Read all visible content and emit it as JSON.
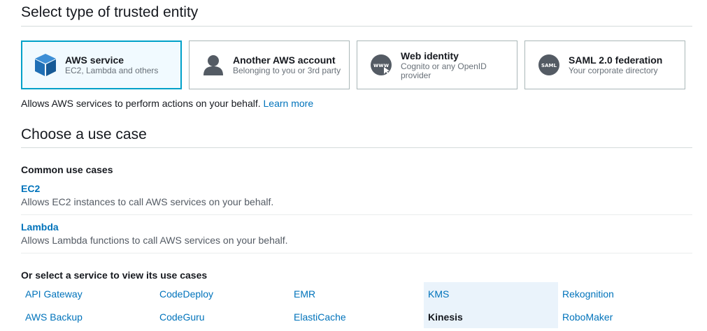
{
  "trusted_entity": {
    "title": "Select type of trusted entity",
    "cards": [
      {
        "title": "AWS service",
        "subtitle": "EC2, Lambda and others",
        "icon": "cube-icon",
        "selected": true
      },
      {
        "title": "Another AWS account",
        "subtitle": "Belonging to you or 3rd party",
        "icon": "person-icon",
        "selected": false
      },
      {
        "title": "Web identity",
        "subtitle": "Cognito or any OpenID provider",
        "icon": "www-icon",
        "selected": false
      },
      {
        "title": "SAML 2.0 federation",
        "subtitle": "Your corporate directory",
        "icon": "saml-icon",
        "selected": false
      }
    ],
    "description": "Allows AWS services to perform actions on your behalf.",
    "learn_more": "Learn more"
  },
  "use_case": {
    "title": "Choose a use case",
    "common_heading": "Common use cases",
    "common": [
      {
        "title": "EC2",
        "description": "Allows EC2 instances to call AWS services on your behalf."
      },
      {
        "title": "Lambda",
        "description": "Allows Lambda functions to call AWS services on your behalf."
      }
    ],
    "services_heading": "Or select a service to view its use cases",
    "services": [
      [
        "API Gateway",
        "AWS Backup"
      ],
      [
        "CodeDeploy",
        "CodeGuru"
      ],
      [
        "EMR",
        "ElastiCache"
      ],
      [
        "KMS",
        "Kinesis"
      ],
      [
        "Rekognition",
        "RoboMaker"
      ]
    ],
    "selected_service": "Kinesis"
  },
  "colors": {
    "link": "#0073bb",
    "selected_border": "#00a1c9",
    "selected_bg": "#f1faff",
    "highlight_bg": "#eaf3fb",
    "icon_blue": "#1f6fb5",
    "icon_gray": "#545b64"
  }
}
